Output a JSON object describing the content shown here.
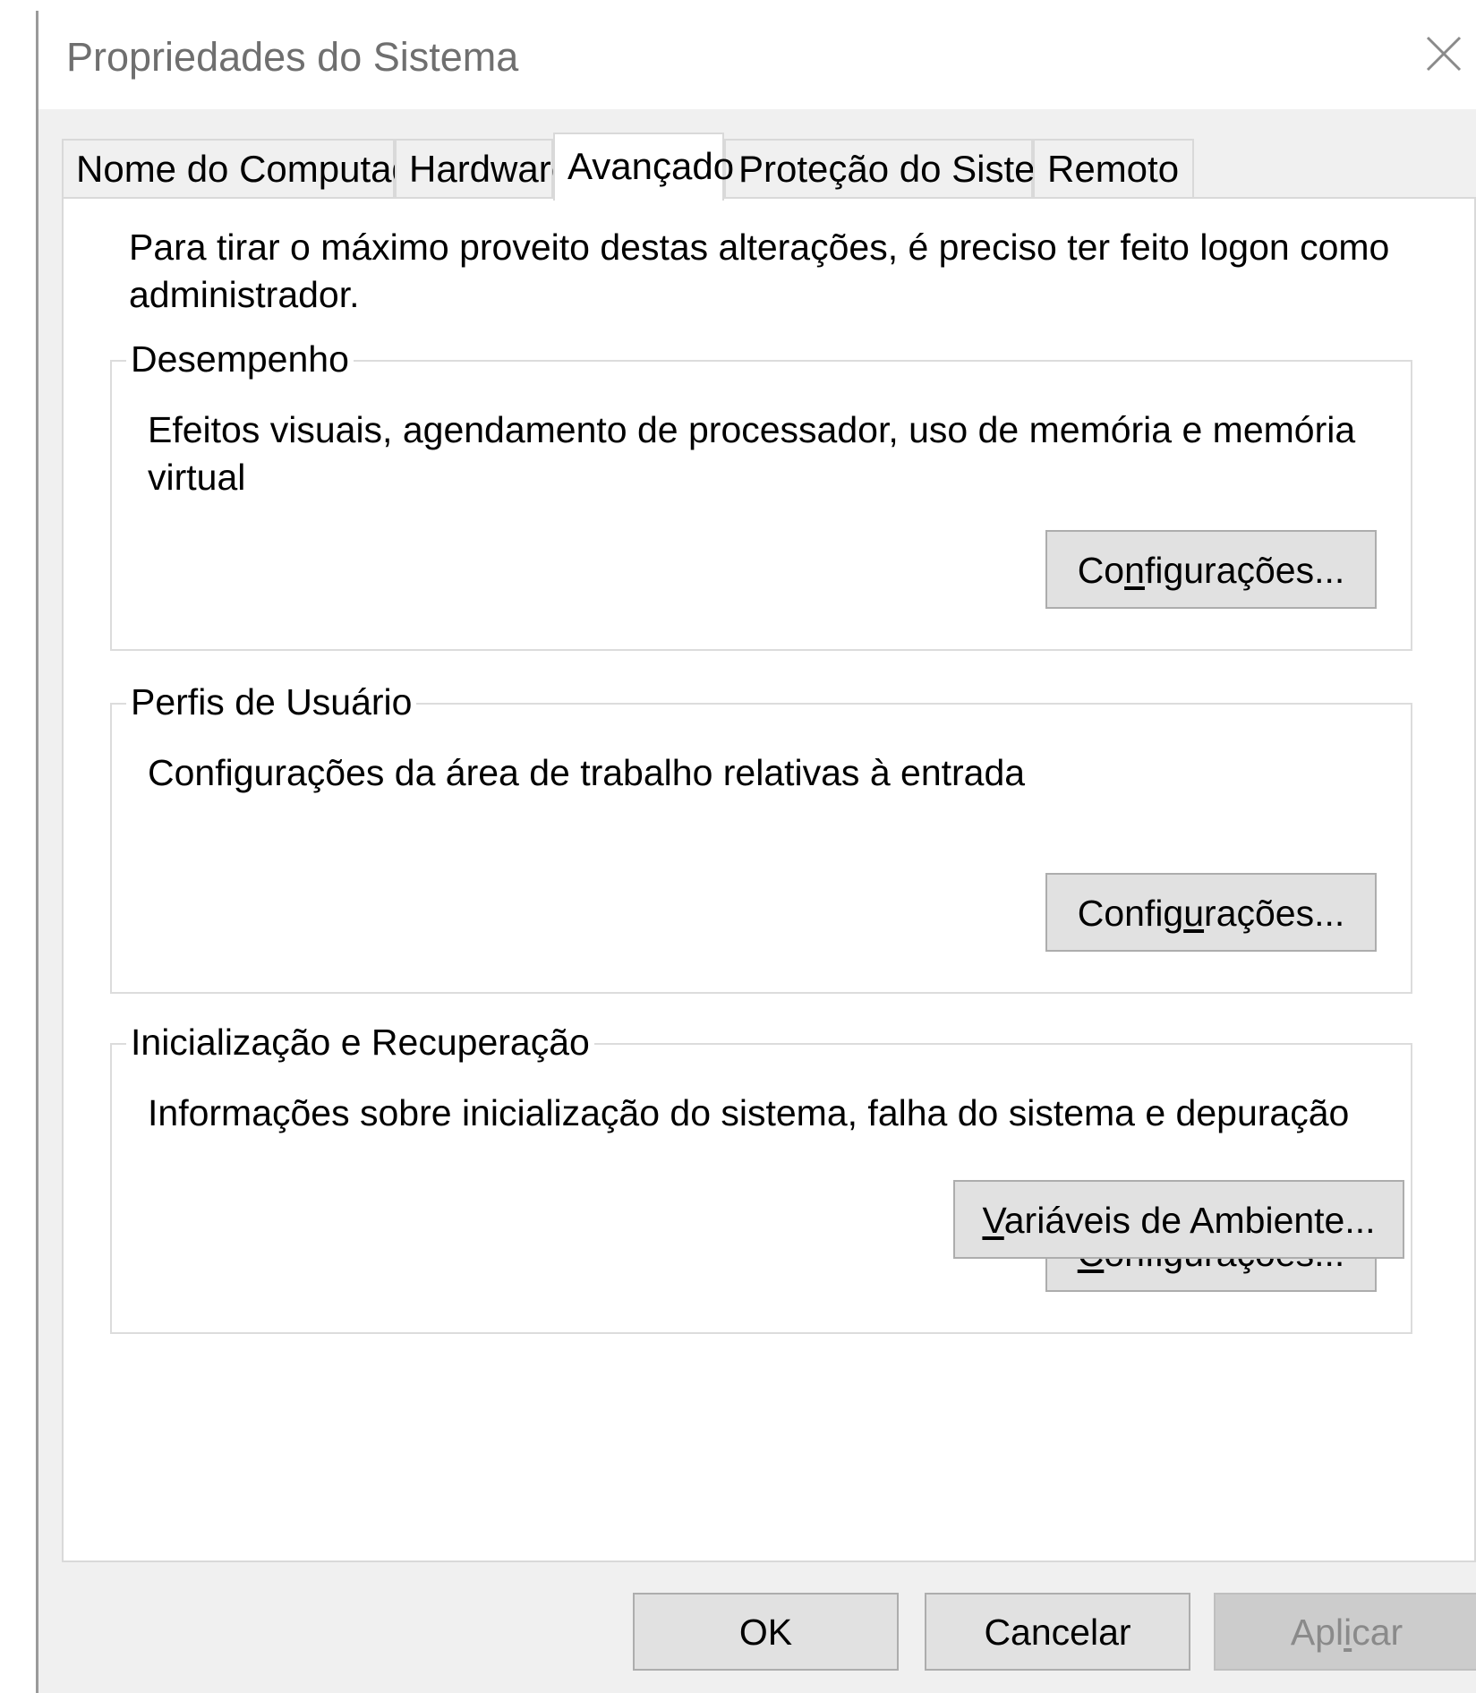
{
  "window": {
    "title": "Propriedades do Sistema",
    "close_icon": "close-icon"
  },
  "tabs": [
    {
      "label": "Nome do Computador",
      "active": false
    },
    {
      "label": "Hardware",
      "active": false
    },
    {
      "label": "Avançado",
      "active": true
    },
    {
      "label": "Proteção do Sistema",
      "active": false
    },
    {
      "label": "Remoto",
      "active": false
    }
  ],
  "advanced": {
    "intro": "Para tirar o máximo proveito destas alterações, é preciso ter feito logon como administrador.",
    "performance": {
      "title": "Desempenho",
      "description": "Efeitos visuais, agendamento de processador, uso de memória e memória virtual",
      "button": {
        "pre": "Co",
        "accel": "n",
        "post": "figurações..."
      }
    },
    "user_profiles": {
      "title": "Perfis de Usuário",
      "description": "Configurações da área de trabalho relativas à entrada",
      "button": {
        "pre": "Config",
        "accel": "u",
        "post": "rações..."
      }
    },
    "startup_recovery": {
      "title": "Inicialização e Recuperação",
      "description": "Informações sobre inicialização do sistema, falha do sistema e depuração",
      "button": {
        "pre": "",
        "accel": "C",
        "post": "onfigurações..."
      }
    },
    "env_vars_button": {
      "pre": "",
      "accel": "V",
      "post": "ariáveis de Ambiente..."
    },
    "highlight_color": "#ffff00"
  },
  "footer": {
    "ok_label": "OK",
    "cancel_label": "Cancelar",
    "apply": {
      "pre": "Apl",
      "accel": "i",
      "post": "car"
    }
  }
}
